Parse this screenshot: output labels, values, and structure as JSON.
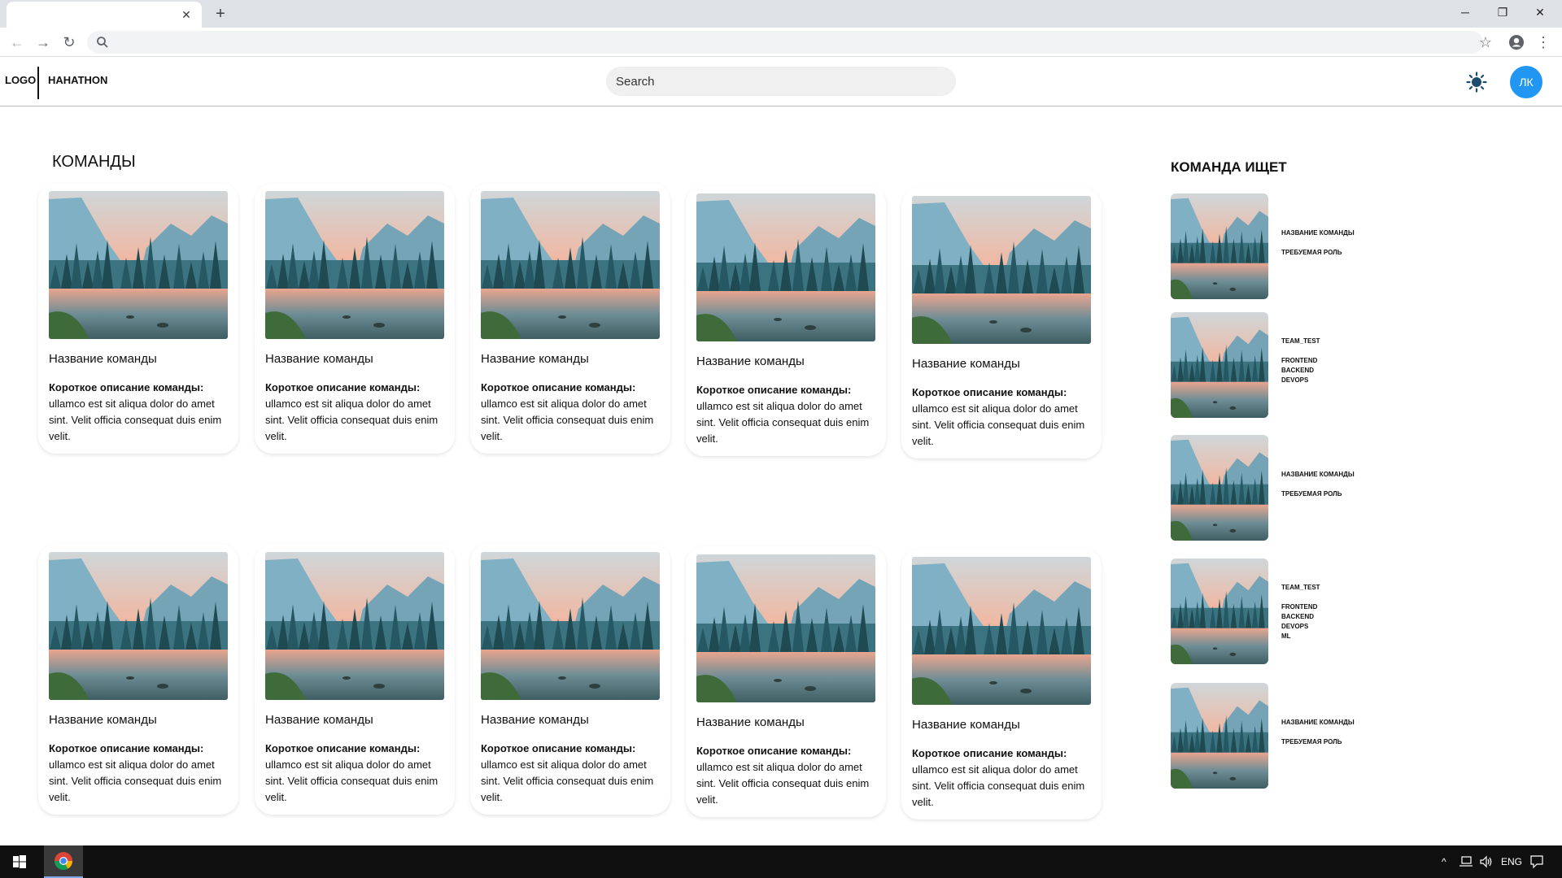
{
  "browser": {
    "tab_close": "✕",
    "new_tab": "+",
    "minimize": "─",
    "restore": "❐",
    "close": "✕",
    "back": "←",
    "forward": "→",
    "reload": "↻",
    "bookmark": "☆",
    "menu": "⋮"
  },
  "header": {
    "logo": "LOGO",
    "brand": "HAHATHON",
    "search_placeholder": "Search",
    "avatar_initials": "ЛК"
  },
  "main": {
    "title": "КОМАНДЫ",
    "cards": [
      {
        "name": "Название команды",
        "desc_label": "Короткое описание команды:",
        "desc": "ullamco est sit aliqua dolor do amet sint. Velit officia consequat duis enim velit."
      },
      {
        "name": "Название команды",
        "desc_label": "Короткое описание команды:",
        "desc": "ullamco est sit aliqua dolor do amet sint. Velit officia consequat duis enim velit."
      },
      {
        "name": "Название команды",
        "desc_label": "Короткое описание команды:",
        "desc": "ullamco est sit aliqua dolor do amet sint. Velit officia consequat duis enim velit."
      },
      {
        "name": "Название команды",
        "desc_label": "Короткое описание команды:",
        "desc": "ullamco est sit aliqua dolor do amet sint. Velit officia consequat duis enim velit."
      },
      {
        "name": "Название команды",
        "desc_label": "Короткое описание команды:",
        "desc": "ullamco est sit aliqua dolor do amet sint. Velit officia consequat duis enim velit."
      },
      {
        "name": "Название команды",
        "desc_label": "Короткое описание команды:",
        "desc": "ullamco est sit aliqua dolor do amet sint. Velit officia consequat duis enim velit."
      },
      {
        "name": "Название команды",
        "desc_label": "Короткое описание команды:",
        "desc": "ullamco est sit aliqua dolor do amet sint. Velit officia consequat duis enim velit."
      },
      {
        "name": "Название команды",
        "desc_label": "Короткое описание команды:",
        "desc": "ullamco est sit aliqua dolor do amet sint. Velit officia consequat duis enim velit."
      },
      {
        "name": "Название команды",
        "desc_label": "Короткое описание команды:",
        "desc": "ullamco est sit aliqua dolor do amet sint. Velit officia consequat duis enim velit."
      },
      {
        "name": "Название команды",
        "desc_label": "Короткое описание команды:",
        "desc": "ullamco est sit aliqua dolor do amet sint. Velit officia consequat duis enim velit."
      }
    ]
  },
  "sidebar": {
    "title": "КОМАНДА ИЩЕТ",
    "items": [
      {
        "title": "НАЗВАНИЕ КОМАНДЫ",
        "lines": [
          "ТРЕБУЕМАЯ РОЛЬ"
        ]
      },
      {
        "title": "TEAM_TEST",
        "lines": [
          "FRONTEND",
          "BACKEND",
          "DEVOPS"
        ]
      },
      {
        "title": "НАЗВАНИЕ КОМАНДЫ",
        "lines": [
          "ТРЕБУЕМАЯ РОЛЬ"
        ]
      },
      {
        "title": "TEAM_TEST",
        "lines": [
          "FRONTEND",
          "BACKEND",
          "DEVOPS",
          "ML"
        ]
      },
      {
        "title": "НАЗВАНИЕ КОМАНДЫ",
        "lines": [
          "ТРЕБУЕМАЯ РОЛЬ"
        ]
      }
    ]
  },
  "taskbar": {
    "tray_chevron": "^",
    "language": "ENG"
  },
  "colors": {
    "accent": "#2196f3",
    "sun": "#1a4d6e"
  },
  "icons": [
    "search-icon",
    "sun-icon",
    "windows-icon",
    "chrome-icon",
    "network-icon",
    "volume-icon",
    "notification-icon"
  ]
}
